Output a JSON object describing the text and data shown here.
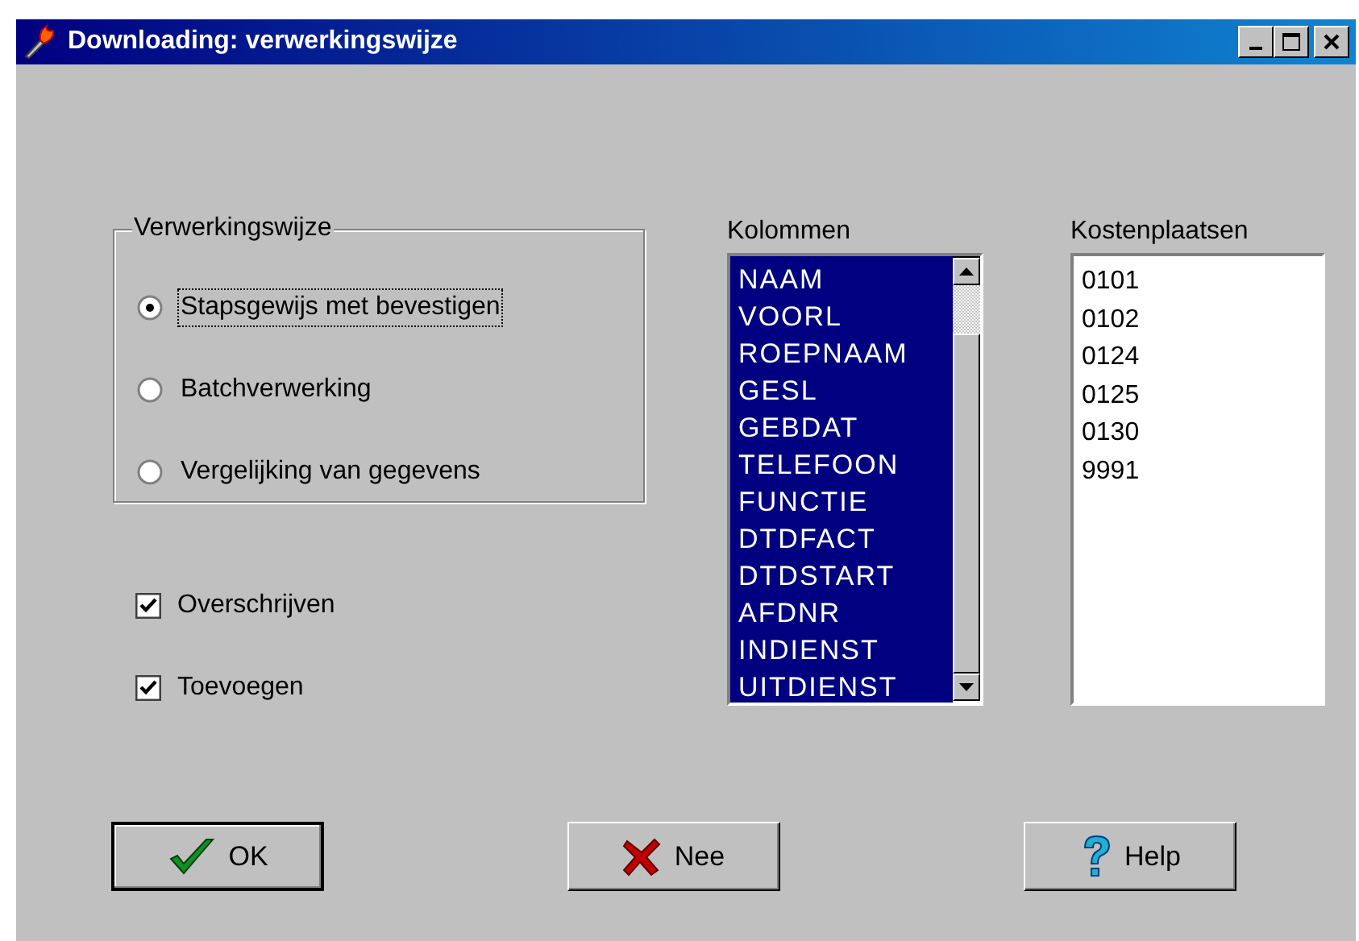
{
  "window": {
    "title": "Downloading: verwerkingswijze"
  },
  "processing": {
    "label": "Verwerkingswijze",
    "options": [
      {
        "label": "Stapsgewijs met bevestigen",
        "selected": true,
        "focused": true
      },
      {
        "label": "Batchverwerking",
        "selected": false,
        "focused": false
      },
      {
        "label": "Vergelijking van gegevens",
        "selected": false,
        "focused": false
      }
    ]
  },
  "checks": [
    {
      "label": "Overschrijven",
      "checked": true
    },
    {
      "label": "Toevoegen",
      "checked": true
    }
  ],
  "columns": {
    "label": "Kolommen",
    "items": [
      {
        "label": "NAAM",
        "selected": true
      },
      {
        "label": "VOORL",
        "selected": true
      },
      {
        "label": "ROEPNAAM",
        "selected": true
      },
      {
        "label": "GESL",
        "selected": true
      },
      {
        "label": "GEBDAT",
        "selected": true
      },
      {
        "label": "TELEFOON",
        "selected": true
      },
      {
        "label": "FUNCTIE",
        "selected": true
      },
      {
        "label": "DTDFACT",
        "selected": true
      },
      {
        "label": "DTDSTART",
        "selected": true
      },
      {
        "label": "AFDNR",
        "selected": true
      },
      {
        "label": "INDIENST",
        "selected": true
      },
      {
        "label": "UITDIENST",
        "selected": true
      }
    ]
  },
  "cost_centers": {
    "label": "Kostenplaatsen",
    "items": [
      "0101",
      "0102",
      "0124",
      "0125",
      "0130",
      "9991"
    ]
  },
  "buttons": [
    {
      "label": "OK",
      "kind": "ok",
      "default": true
    },
    {
      "label": "Nee",
      "kind": "no",
      "default": false
    },
    {
      "label": "Help",
      "kind": "help",
      "default": false
    }
  ]
}
